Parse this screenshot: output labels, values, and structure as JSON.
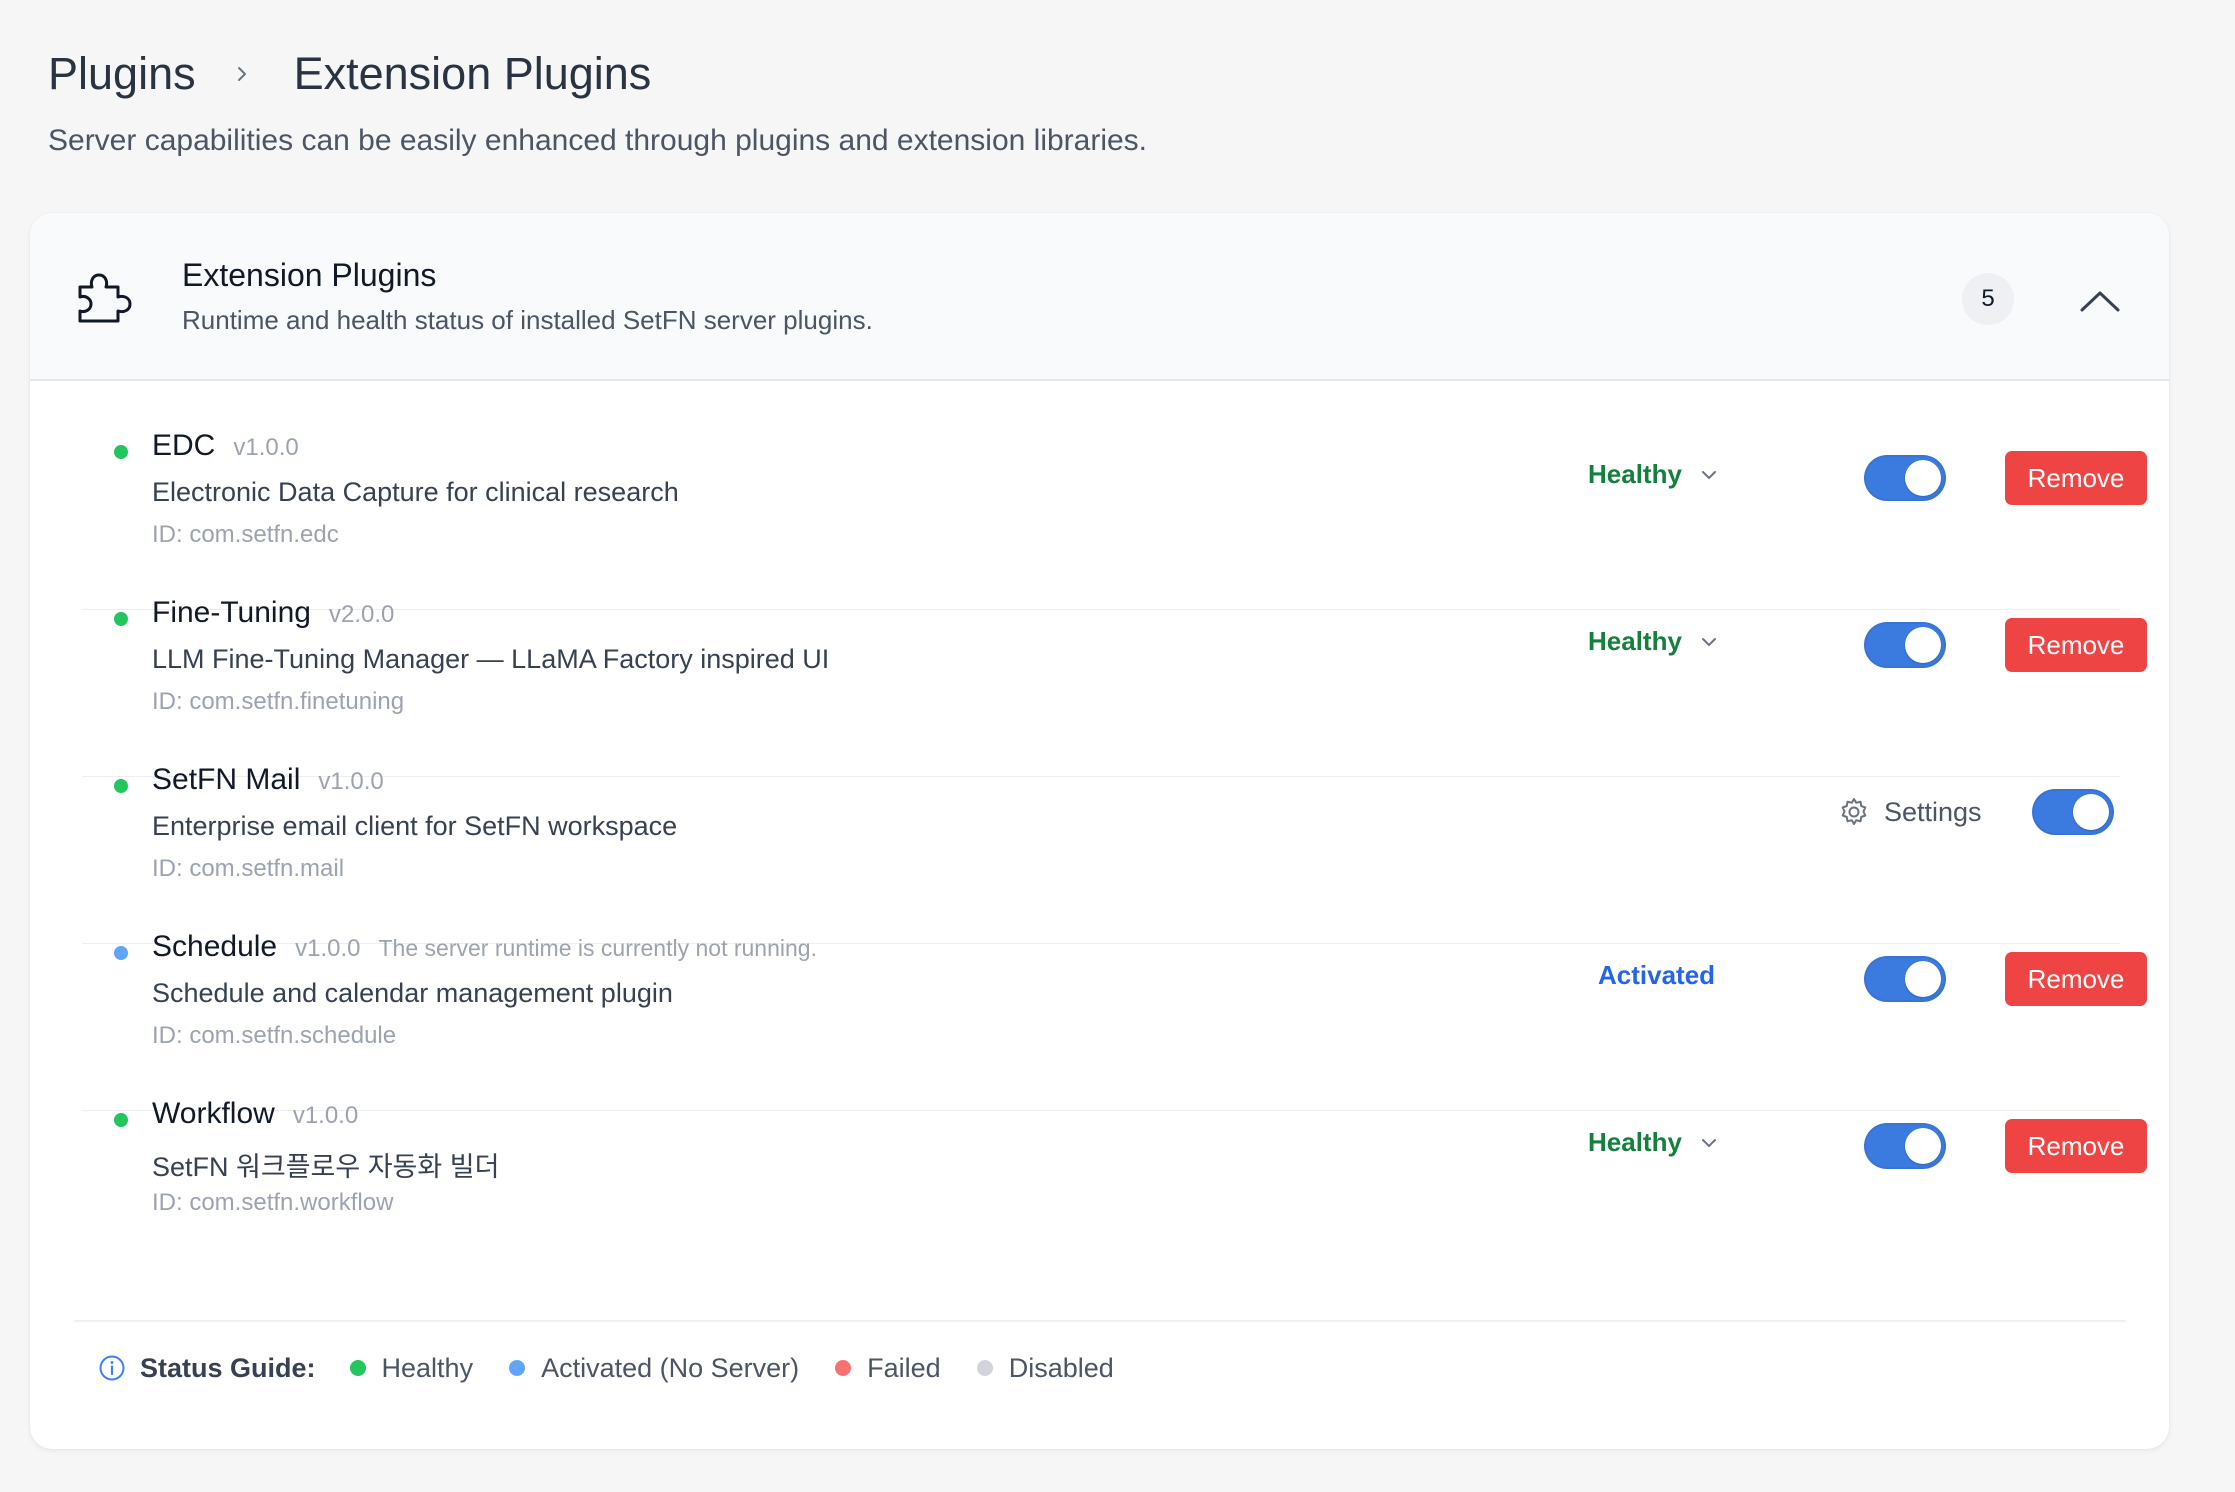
{
  "breadcrumb": {
    "root": "Plugins",
    "current": "Extension Plugins"
  },
  "page": {
    "description": "Server capabilities can be easily enhanced through plugins and extension libraries."
  },
  "card": {
    "title": "Extension Plugins",
    "subtitle": "Runtime and health status of installed SetFN server plugins.",
    "count": "5",
    "icon": "puzzle-icon"
  },
  "plugins": [
    {
      "name": "EDC",
      "version": "v1.0.0",
      "note": "",
      "description": "Electronic Data Capture for clinical research",
      "id": "ID: com.setfn.edc",
      "status": "Healthy",
      "enabled": true,
      "action": "Remove",
      "dot_color": "#22c55e"
    },
    {
      "name": "Fine-Tuning",
      "version": "v2.0.0",
      "note": "",
      "description": "LLM Fine-Tuning Manager — LLaMA Factory inspired UI",
      "id": "ID: com.setfn.finetuning",
      "status": "Healthy",
      "enabled": true,
      "action": "Remove",
      "dot_color": "#22c55e"
    },
    {
      "name": "SetFN Mail",
      "version": "v1.0.0",
      "note": "",
      "description": "Enterprise email client for SetFN workspace",
      "id": "ID: com.setfn.mail",
      "status": "",
      "enabled": true,
      "action": "Settings",
      "dot_color": "#22c55e"
    },
    {
      "name": "Schedule",
      "version": "v1.0.0",
      "note": "The server runtime is currently not running.",
      "description": "Schedule and calendar management plugin",
      "id": "ID: com.setfn.schedule",
      "status": "Activated",
      "enabled": true,
      "action": "Remove",
      "dot_color": "#60a5fa"
    },
    {
      "name": "Workflow",
      "version": "v1.0.0",
      "note": "",
      "description": "SetFN 워크플로우 자동화 빌더",
      "id": "ID: com.setfn.workflow",
      "status": "Healthy",
      "enabled": true,
      "action": "Remove",
      "dot_color": "#22c55e"
    }
  ],
  "legend": {
    "title": "Status Guide:",
    "items": [
      {
        "label": "Healthy",
        "color": "#22c55e"
      },
      {
        "label": "Activated (No Server)",
        "color": "#60a5fa"
      },
      {
        "label": "Failed",
        "color": "#f87171"
      },
      {
        "label": "Disabled",
        "color": "#d1d5db"
      }
    ]
  },
  "colors": {
    "accent": "#3b7be0",
    "danger": "#ef4444",
    "healthy_text": "#15803d",
    "activated_text": "#2563eb"
  }
}
